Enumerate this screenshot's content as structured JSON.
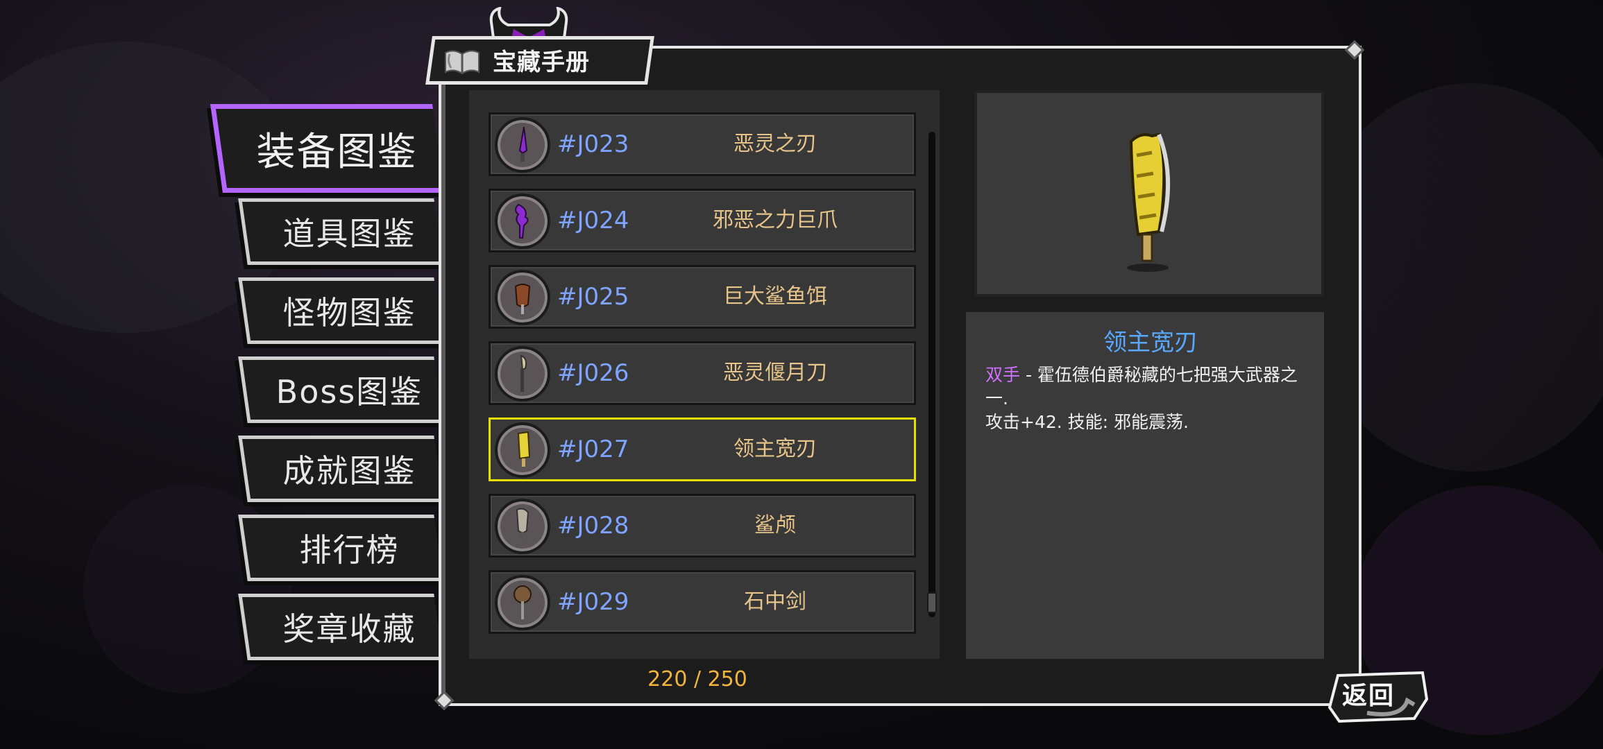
{
  "title": "宝藏手册",
  "tabs": [
    {
      "label": "装备图鉴",
      "active": true
    },
    {
      "label": "道具图鉴",
      "active": false
    },
    {
      "label": "怪物图鉴",
      "active": false
    },
    {
      "label": "Boss图鉴",
      "active": false
    },
    {
      "label": "成就图鉴",
      "active": false
    },
    {
      "label": "排行榜",
      "active": false
    },
    {
      "label": "奖章收藏",
      "active": false
    }
  ],
  "list": {
    "items": [
      {
        "code": "#J023",
        "name": "恶灵之刃",
        "selected": false
      },
      {
        "code": "#J024",
        "name": "邪恶之力巨爪",
        "selected": false
      },
      {
        "code": "#J025",
        "name": "巨大鲨鱼饵",
        "selected": false
      },
      {
        "code": "#J026",
        "name": "恶灵偃月刀",
        "selected": false
      },
      {
        "code": "#J027",
        "name": "领主宽刃",
        "selected": true
      },
      {
        "code": "#J028",
        "name": "鲨颅",
        "selected": false
      },
      {
        "code": "#J029",
        "name": "石中剑",
        "selected": false
      }
    ],
    "counter": "220 / 250"
  },
  "detail": {
    "name": "领主宽刃",
    "tag": "双手",
    "line1": " - 霍伍德伯爵秘藏的七把强大武器之一.",
    "line2": "攻击+42. 技能: 邪能震荡."
  },
  "back_label": "返回",
  "colors": {
    "accent": "#b464ff",
    "selected": "#e6e000",
    "code": "#7fa4ff",
    "item_name": "#e7c48a",
    "counter": "#f2b43a",
    "detail_title": "#58a8ff"
  }
}
